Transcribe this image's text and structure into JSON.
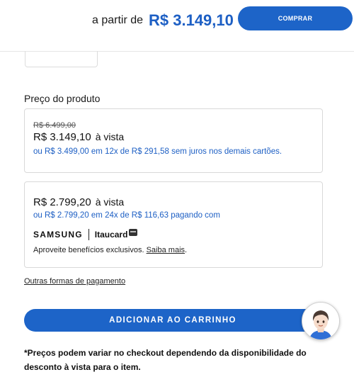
{
  "header": {
    "from_label": "a partir de",
    "price": "R$ 3.149,10",
    "buy_label": "COMPRAR"
  },
  "section_title": "Preço do produto",
  "offer_cash": {
    "old_price": "R$ 6.499,00",
    "price": "R$ 3.149,10",
    "suffix": "à vista",
    "or": "ou",
    "installment_total": "R$ 3.499,00",
    "em": "em",
    "installment_count": "12x de",
    "installment_value": "R$ 291,58",
    "installment_note": "sem juros nos demais cartões."
  },
  "offer_card": {
    "price": "R$ 2.799,20",
    "suffix": "à vista",
    "or": "ou",
    "installment_total": "R$ 2.799,20",
    "em": "em",
    "installment_count": "24x de",
    "installment_value": "R$ 116,63",
    "installment_note": "pagando com",
    "brand_samsung": "SAMSUNG",
    "brand_itaucard": "Itaucard",
    "benefits_text": "Aproveite benefícios exclusivos.",
    "benefits_link": "Saiba mais",
    "benefits_end": "."
  },
  "other_payment_link": "Outras formas de pagamento",
  "add_to_cart_label": "ADICIONAR AO CARRINHO",
  "disclaimer": "*Preços podem variar no checkout dependendo da disponibilidade do desconto à vista para o item.",
  "icons": {
    "card": "card-icon",
    "assistant": "assistant-avatar-icon"
  },
  "colors": {
    "accent": "#1d64c8",
    "price_blue": "#1d5fc4"
  }
}
